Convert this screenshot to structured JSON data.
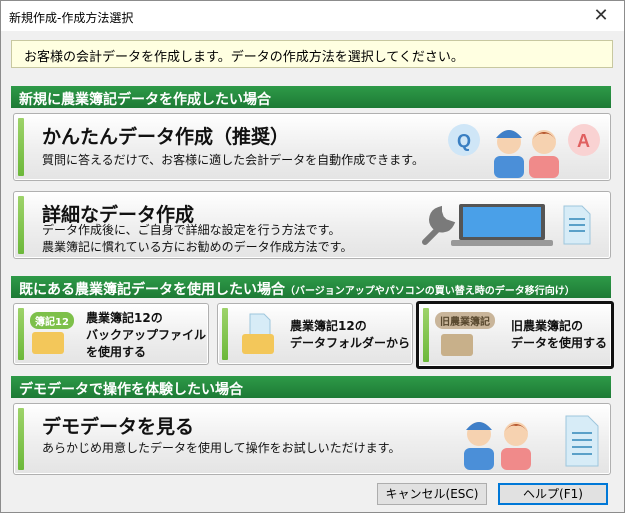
{
  "window": {
    "title": "新規作成-作成方法選択",
    "close": "✕"
  },
  "banner": "お客様の会計データを作成します。データの作成方法を選択してください。",
  "sections": {
    "new": "新規に農業簿記データを作成したい場合",
    "existing": "既にある農業簿記データを使用したい場合",
    "existing_note": "（バージョンアップやパソコンの買い替え時のデータ移行向け）",
    "demo": "デモデータで操作を体験したい場合"
  },
  "options": {
    "easy": {
      "title": "かんたんデータ作成（推奨）",
      "desc": "質問に答えるだけで、お客様に適した会計データを自動作成できます。",
      "q": "Q",
      "a": "A"
    },
    "detail": {
      "title": "詳細なデータ作成",
      "desc1": "データ作成後に、ご自身で詳細な設定を行う方法です。",
      "desc2": "農業簿記に慣れている方にお勧めのデータ作成方法です。"
    },
    "backup": {
      "tag": "簿記12",
      "line1": "農業簿記12の",
      "line2": "バックアップファイル",
      "line3": "を使用する"
    },
    "folder": {
      "line1": "農業簿記12の",
      "line2": "データフォルダーから"
    },
    "old": {
      "tag": "旧農業簿記",
      "line1": "旧農業簿記の",
      "line2": "データを使用する"
    },
    "demo": {
      "title": "デモデータを見る",
      "desc": "あらかじめ用意したデータを使用して操作をお試しいただけます。"
    }
  },
  "footer": {
    "cancel": "キャンセル(ESC)",
    "help": "ヘルプ(F1)"
  }
}
